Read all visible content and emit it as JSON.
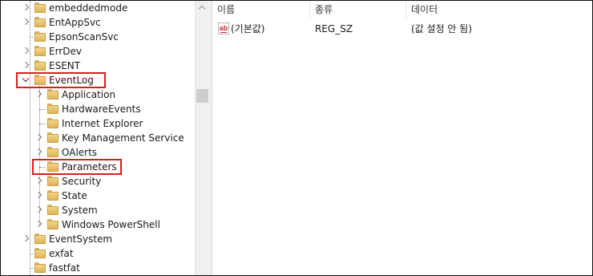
{
  "tree": {
    "items": [
      {
        "label": "embeddedmode",
        "level": 1,
        "expander": "right"
      },
      {
        "label": "EntAppSvc",
        "level": 1,
        "expander": "right"
      },
      {
        "label": "EpsonScanSvc",
        "level": 1,
        "expander": "none"
      },
      {
        "label": "ErrDev",
        "level": 1,
        "expander": "right"
      },
      {
        "label": "ESENT",
        "level": 1,
        "expander": "right"
      },
      {
        "label": "EventLog",
        "level": 1,
        "expander": "down",
        "highlighted": true
      },
      {
        "label": "Application",
        "level": 2,
        "expander": "right"
      },
      {
        "label": "HardwareEvents",
        "level": 2,
        "expander": "none"
      },
      {
        "label": "Internet Explorer",
        "level": 2,
        "expander": "none"
      },
      {
        "label": "Key Management Service",
        "level": 2,
        "expander": "right"
      },
      {
        "label": "OAlerts",
        "level": 2,
        "expander": "right"
      },
      {
        "label": "Parameters",
        "level": 2,
        "expander": "none",
        "highlighted": true,
        "selected": true
      },
      {
        "label": "Security",
        "level": 2,
        "expander": "right"
      },
      {
        "label": "State",
        "level": 2,
        "expander": "right"
      },
      {
        "label": "System",
        "level": 2,
        "expander": "right"
      },
      {
        "label": "Windows PowerShell",
        "level": 2,
        "expander": "right"
      },
      {
        "label": "EventSystem",
        "level": 1,
        "expander": "right"
      },
      {
        "label": "exfat",
        "level": 1,
        "expander": "none"
      },
      {
        "label": "fastfat",
        "level": 1,
        "expander": "none"
      }
    ]
  },
  "list": {
    "columns": [
      "이름",
      "종류",
      "데이터"
    ],
    "rows": [
      {
        "icon": "string-value-icon",
        "icon_text": "ab",
        "name": "(기본값)",
        "type": "REG_SZ",
        "data": "(값 설정 안 됨)"
      }
    ]
  },
  "colors": {
    "highlight": "#e01c1c",
    "folder": "#f3d58a"
  }
}
